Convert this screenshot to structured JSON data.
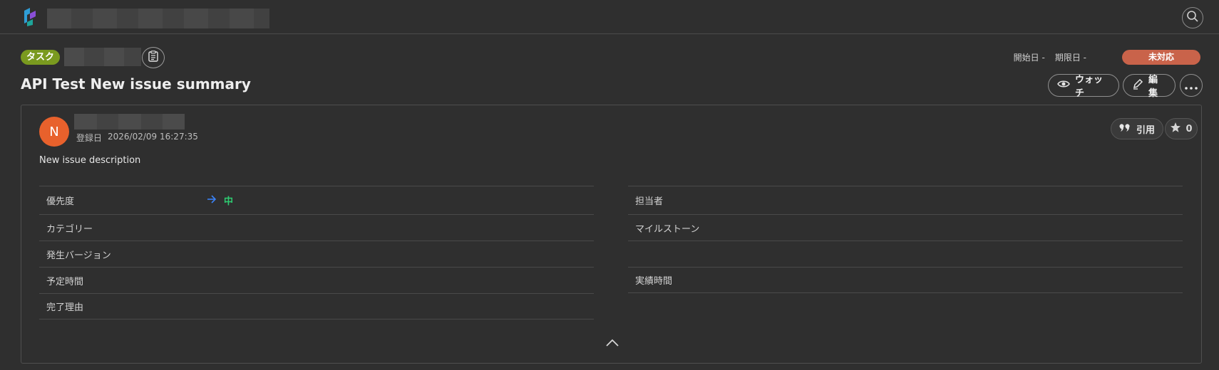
{
  "colors": {
    "background": "#2f2f2f",
    "task_badge": "#7a9a1f",
    "status_badge": "#c9634a",
    "avatar": "#e8612c",
    "priority_text": "#2ecc71",
    "priority_arrow": "#3b82f6"
  },
  "issue": {
    "type_label": "タスク",
    "title": "API Test New issue summary",
    "start_date_label": "開始日",
    "start_date_value": "-",
    "due_date_label": "期限日",
    "due_date_value": "-",
    "status": "未対応"
  },
  "actions": {
    "watch_label": "ウォッチ",
    "edit_label": "編集",
    "quote_label": "引用",
    "star_count": "0"
  },
  "comment": {
    "avatar_letter": "N",
    "created_label": "登録日",
    "created_value": "2026/02/09 16:27:35",
    "description": "New issue description"
  },
  "properties": {
    "left": [
      {
        "label": "優先度",
        "value": "中"
      },
      {
        "label": "カテゴリー",
        "value": ""
      },
      {
        "label": "発生バージョン",
        "value": ""
      },
      {
        "label": "予定時間",
        "value": ""
      },
      {
        "label": "完了理由",
        "value": ""
      }
    ],
    "right": [
      {
        "label": "担当者",
        "value": ""
      },
      {
        "label": "マイルストーン",
        "value": ""
      },
      {
        "label": "",
        "value": ""
      },
      {
        "label": "実績時間",
        "value": ""
      }
    ]
  },
  "icons": {
    "search": "search-icon",
    "copy": "clipboard-icon",
    "watch": "eye-icon",
    "edit": "pencil-icon",
    "more": "more-dots-icon",
    "quote": "quote-icon",
    "star": "star-icon",
    "priority": "arrow-right-icon",
    "collapse": "chevron-up-icon"
  }
}
